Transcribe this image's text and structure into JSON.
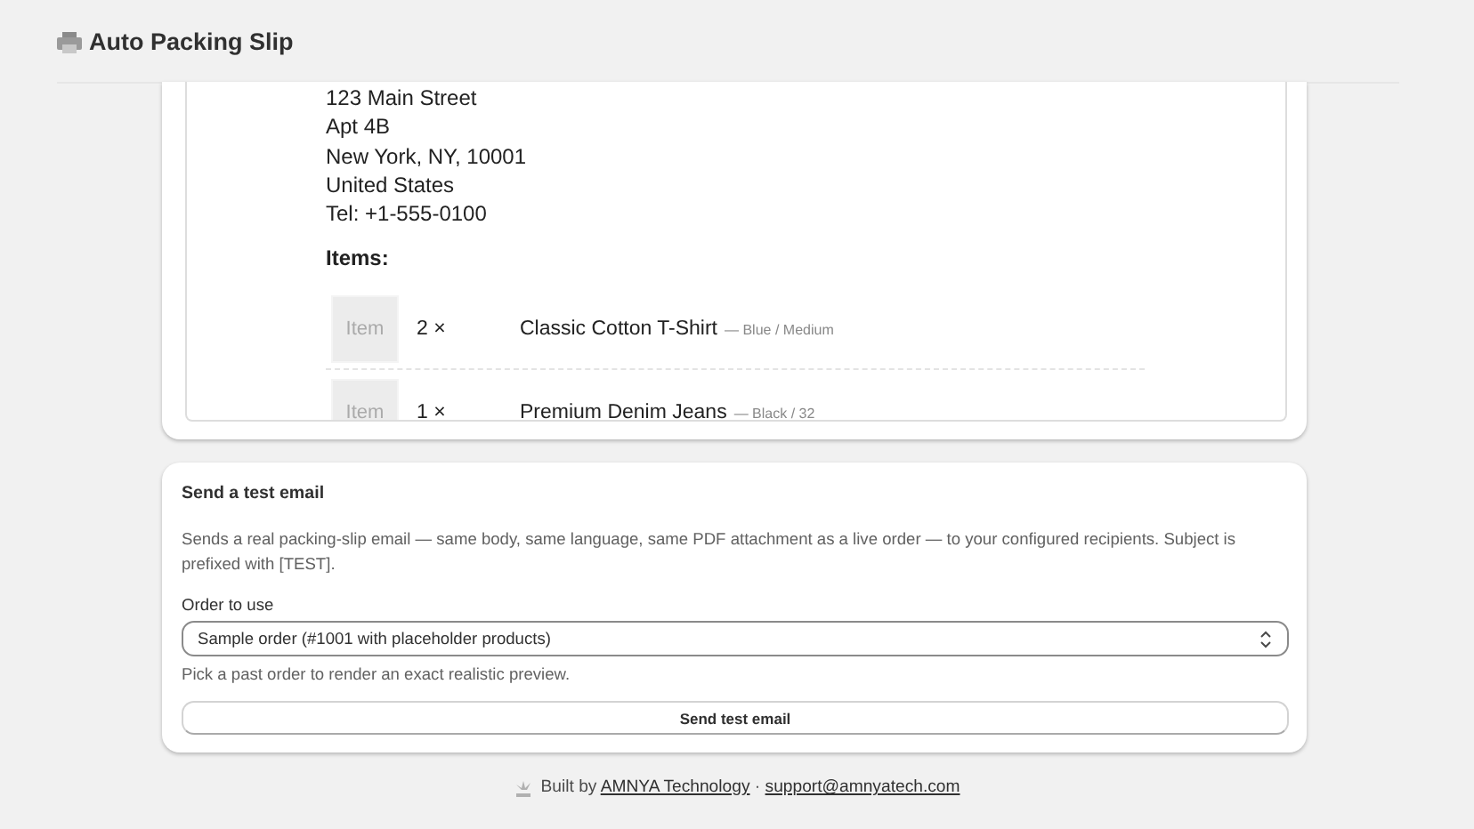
{
  "header": {
    "title": "Auto Packing Slip"
  },
  "preview": {
    "address_lines": [
      "123 Main Street",
      "Apt 4B",
      "New York, NY, 10001",
      "United States",
      "Tel: +1-555-0100"
    ],
    "items_heading": "Items:",
    "items": [
      {
        "thumbnail": "Item",
        "quantity": "2 ×",
        "name": "Classic Cotton T-Shirt",
        "variant": "— Blue / Medium"
      },
      {
        "thumbnail": "Item",
        "quantity": "1 ×",
        "name": "Premium Denim Jeans",
        "variant": "— Black / 32"
      }
    ]
  },
  "test_email": {
    "title": "Send a test email",
    "description": "Sends a real packing-slip email — same body, same language, same PDF attachment as a live order — to your configured recipients. Subject is prefixed with [TEST].",
    "order_field": {
      "label": "Order to use",
      "value": "Sample order (#1001 with placeholder products)",
      "help": "Pick a past order to render an exact realistic preview."
    },
    "button": "Send test email"
  },
  "footer": {
    "prefix": "Built by",
    "link": "AMNYA Technology",
    "separator": "·",
    "email": "support@amnyatech.com"
  }
}
